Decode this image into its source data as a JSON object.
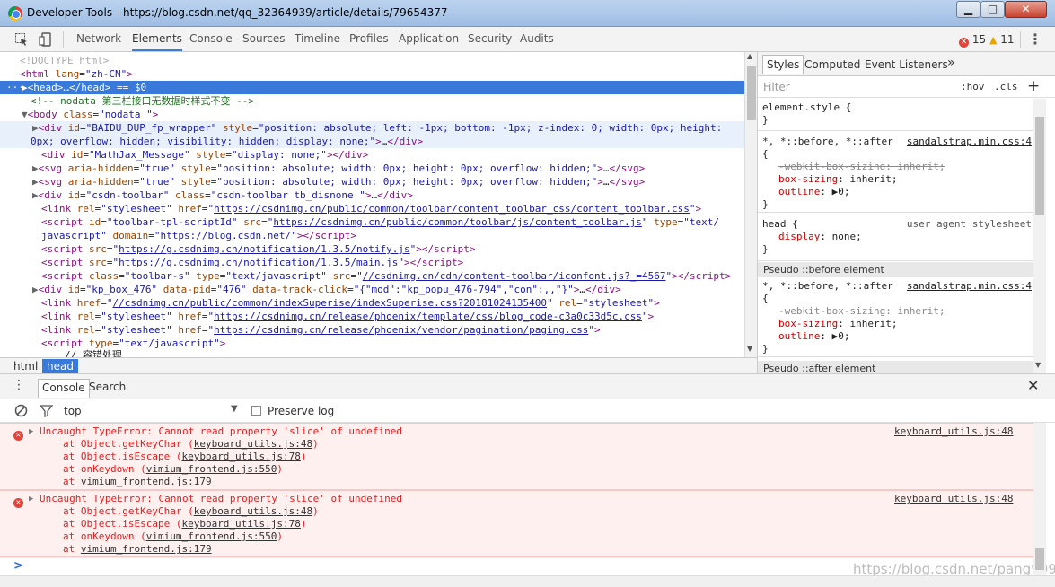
{
  "window": {
    "title": "Developer Tools - https://blog.csdn.net/qq_32364939/article/details/79654377",
    "min_glyph": "▁",
    "max_glyph": "□",
    "close_glyph": "✕"
  },
  "toolbar": {
    "tabs": [
      "Network",
      "Elements",
      "Console",
      "Sources",
      "Timeline",
      "Profiles",
      "Application",
      "Security",
      "Audits"
    ],
    "active_tab": "Elements",
    "error_count": "15",
    "warning_count": "11"
  },
  "elements": {
    "lines": [
      {
        "html": "<span class='dt'>&lt;!DOCTYPE html&gt;</span>"
      },
      {
        "html": "<span class='tag'>&lt;html</span> <span class='an'>lang</span>=<span class='av'>\"zh-CN\"</span><span class='tag'>&gt;</span>"
      },
      {
        "html": "<span class='tri'>▶</span><span class='tag'>&lt;head&gt;</span>…<span class='tag'>&lt;/head&gt;</span> == $0"
      },
      {
        "html": "<span class='cm'>&lt;!-- nodata 第三栏接口无数据时样式不变 --&gt;</span>"
      },
      {
        "html": "<span class='tri'>▼</span><span class='tag'>&lt;body</span> <span class='an'>class</span>=<span class='av'>\"nodata \"</span><span class='tag'>&gt;</span>"
      },
      {
        "html": "<span class='tri'>▶</span><span class='tag'>&lt;div</span> <span class='an'>id</span>=<span class='av'>\"BAIDU_DUP_fp_wrapper\"</span> <span class='an'>style</span>=<span class='av'>\"position: absolute; left: -1px; bottom: -1px; z-index: 0; width: 0px; height:</span>"
      },
      {
        "html": "<span class='av'>0px; overflow: hidden; visibility: hidden; display: none;\"</span><span class='tag'>&gt;</span>…<span class='tag'>&lt;/div&gt;</span>"
      },
      {
        "html": "<span class='tag'>&lt;div</span> <span class='an'>id</span>=<span class='av'>\"MathJax_Message\"</span> <span class='an'>style</span>=<span class='av'>\"display: none;\"</span><span class='tag'>&gt;&lt;/div&gt;</span>"
      },
      {
        "html": "<span class='tri'>▶</span><span class='tag'>&lt;svg</span> <span class='an'>aria-hidden</span>=<span class='av'>\"true\"</span> <span class='an'>style</span>=<span class='av'>\"position: absolute; width: 0px; height: 0px; overflow: hidden;\"</span><span class='tag'>&gt;</span>…<span class='tag'>&lt;/svg&gt;</span>"
      },
      {
        "html": "<span class='tri'>▶</span><span class='tag'>&lt;svg</span> <span class='an'>aria-hidden</span>=<span class='av'>\"true\"</span> <span class='an'>style</span>=<span class='av'>\"position: absolute; width: 0px; height: 0px; overflow: hidden;\"</span><span class='tag'>&gt;</span>…<span class='tag'>&lt;/svg&gt;</span>"
      },
      {
        "html": "<span class='tri'>▶</span><span class='tag'>&lt;div</span> <span class='an'>id</span>=<span class='av'>\"csdn-toolbar\"</span> <span class='an'>class</span>=<span class='av'>\"csdn-toolbar tb_disnone \"</span><span class='tag'>&gt;</span>…<span class='tag'>&lt;/div&gt;</span>"
      },
      {
        "html": "<span class='tag'>&lt;link</span> <span class='an'>rel</span>=<span class='av'>\"stylesheet\"</span> <span class='an'>href</span>=<span class='av'>\"</span><span class='lnk'>https://csdnimg.cn/public/common/toolbar/content_toolbar_css/content_toolbar.css</span><span class='av'>\"</span><span class='tag'>&gt;</span>"
      },
      {
        "html": "<span class='tag'>&lt;script</span> <span class='an'>id</span>=<span class='av'>\"toolbar-tpl-scriptId\"</span> <span class='an'>src</span>=<span class='av'>\"</span><span class='lnk'>https://csdnimg.cn/public/common/toolbar/js/content_toolbar.js</span><span class='av'>\"</span> <span class='an'>type</span>=<span class='av'>\"text/</span>"
      },
      {
        "html": "<span class='av'>javascript\"</span> <span class='an'>domain</span>=<span class='av'>\"https://blog.csdn.net/\"</span><span class='tag'>&gt;&lt;/script&gt;</span>"
      },
      {
        "html": "<span class='tag'>&lt;script</span> <span class='an'>src</span>=<span class='av'>\"</span><span class='lnk'>https://g.csdnimg.cn/notification/1.3.5/notify.js</span><span class='av'>\"</span><span class='tag'>&gt;&lt;/script&gt;</span>"
      },
      {
        "html": "<span class='tag'>&lt;script</span> <span class='an'>src</span>=<span class='av'>\"</span><span class='lnk'>https://g.csdnimg.cn/notification/1.3.5/main.js</span><span class='av'>\"</span><span class='tag'>&gt;&lt;/script&gt;</span>"
      },
      {
        "html": "<span class='tag'>&lt;script</span> <span class='an'>class</span>=<span class='av'>\"toolbar-s\"</span> <span class='an'>type</span>=<span class='av'>\"text/javascript\"</span> <span class='an'>src</span>=<span class='av'>\"</span><span class='lnk'>//csdnimg.cn/cdn/content-toolbar/iconfont.js?_=4567</span><span class='av'>\"</span><span class='tag'>&gt;&lt;/script&gt;</span>"
      },
      {
        "html": "<span class='tri'>▶</span><span class='tag'>&lt;div</span> <span class='an'>id</span>=<span class='av'>\"kp_box_476\"</span> <span class='an'>data-pid</span>=<span class='av'>\"476\"</span> <span class='an'>data-track-click</span>=<span class='av'>\"{\"mod\":\"kp_popu_476-794\",\"con\":,,\"}\"</span><span class='tag'>&gt;</span>…<span class='tag'>&lt;/div&gt;</span>"
      },
      {
        "html": "<span class='tag'>&lt;link</span> <span class='an'>href</span>=<span class='av'>\"</span><span class='lnk'>//csdnimg.cn/public/common/indexSuperise/indexSuperise.css?20181024135400</span><span class='av'>\"</span> <span class='an'>rel</span>=<span class='av'>\"stylesheet\"</span><span class='tag'>&gt;</span>"
      },
      {
        "html": "<span class='tag'>&lt;link</span> <span class='an'>rel</span>=<span class='av'>\"stylesheet\"</span> <span class='an'>href</span>=<span class='av'>\"</span><span class='lnk'>https://csdnimg.cn/release/phoenix/template/css/blog_code-c3a0c33d5c.css</span><span class='av'>\"</span><span class='tag'>&gt;</span>"
      },
      {
        "html": "<span class='tag'>&lt;link</span> <span class='an'>rel</span>=<span class='av'>\"stylesheet\"</span> <span class='an'>href</span>=<span class='av'>\"</span><span class='lnk'>https://csdnimg.cn/release/phoenix/vendor/pagination/paging.css</span><span class='av'>\"</span><span class='tag'>&gt;</span>"
      },
      {
        "html": "<span class='tag'>&lt;script</span> <span class='an'>type</span>=<span class='av'>\"text/javascript\"</span><span class='tag'>&gt;</span>"
      },
      {
        "html": "// 容错处理"
      }
    ]
  },
  "breadcrumb": [
    "html",
    "head"
  ],
  "styles": {
    "tabs": [
      "Styles",
      "Computed",
      "Event Listeners"
    ],
    "more_glyph": "»",
    "filter_placeholder": "Filter",
    "hov": ":hov",
    "cls": ".cls",
    "plus": "+",
    "rule1_selector": "element.style {",
    "rule1_close": "}",
    "rule2_selector": "*, *::before, *::after",
    "rule2_source": "sandalstrap.min.css:4",
    "open_brace": "{",
    "close_brace": "}",
    "webkit_prop": "-webkit-box-sizing",
    "boxsizing_prop": "box-sizing",
    "inherit_value": "inherit",
    "outline_prop": "outline",
    "outline_value": "▶0",
    "rule3_selector": "head {",
    "rule3_source": "user agent stylesheet",
    "display_prop": "display",
    "display_value": "none",
    "pseudo_before": "Pseudo ::before element",
    "pseudo_after": "Pseudo ::after element"
  },
  "drawer": {
    "tabs": [
      "Console",
      "Search"
    ],
    "context": "top",
    "preserve_log": "Preserve log",
    "messages": [
      {
        "text": "Uncaught TypeError: Cannot read property 'slice' of undefined",
        "location": "keyboard_utils.js:48",
        "stack": [
          {
            "fn": "at Object.getKeyChar (",
            "file": "keyboard_utils.js:48",
            "tail": ")"
          },
          {
            "fn": "at Object.isEscape (",
            "file": "keyboard_utils.js:78",
            "tail": ")"
          },
          {
            "fn": "at onKeydown (",
            "file": "vimium_frontend.js:550",
            "tail": ")"
          },
          {
            "fn": "at ",
            "file": "vimium_frontend.js:179",
            "tail": ""
          }
        ]
      },
      {
        "text": "Uncaught TypeError: Cannot read property 'slice' of undefined",
        "location": "keyboard_utils.js:48",
        "stack": [
          {
            "fn": "at Object.getKeyChar (",
            "file": "keyboard_utils.js:48",
            "tail": ")"
          },
          {
            "fn": "at Object.isEscape (",
            "file": "keyboard_utils.js:78",
            "tail": ")"
          },
          {
            "fn": "at onKeydown (",
            "file": "vimium_frontend.js:550",
            "tail": ")"
          },
          {
            "fn": "at ",
            "file": "vimium_frontend.js:179",
            "tail": ""
          }
        ]
      }
    ],
    "prompt": ">",
    "watermark": "https://blog.csdn.net/pang9998"
  }
}
